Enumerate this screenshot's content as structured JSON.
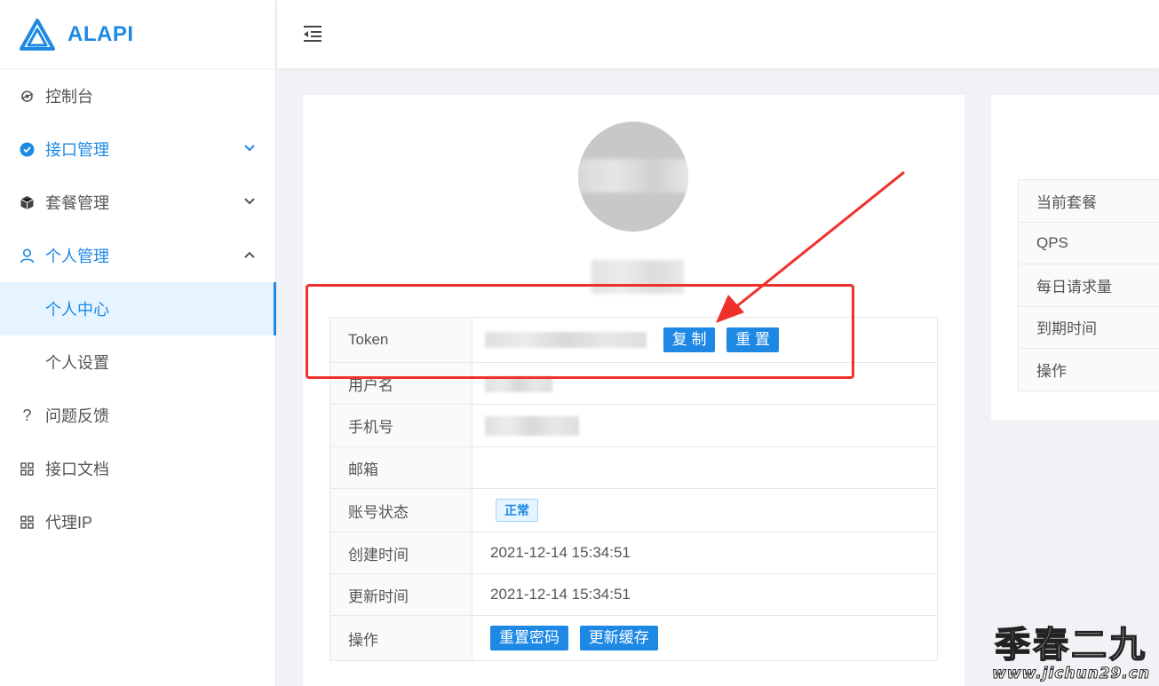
{
  "brand": {
    "name": "ALAPI"
  },
  "sidebar": {
    "items": [
      {
        "label": "控制台"
      },
      {
        "label": "接口管理"
      },
      {
        "label": "套餐管理"
      },
      {
        "label": "个人管理"
      },
      {
        "label": "个人中心"
      },
      {
        "label": "个人设置"
      },
      {
        "label": "问题反馈"
      },
      {
        "label": "接口文档"
      },
      {
        "label": "代理IP"
      }
    ]
  },
  "profile": {
    "rows": {
      "token": {
        "label": "Token",
        "copy_button": "复 制",
        "reset_button": "重 置"
      },
      "username": {
        "label": "用户名"
      },
      "phone": {
        "label": "手机号"
      },
      "email": {
        "label": "邮箱"
      },
      "status": {
        "label": "账号状态",
        "value": "正常"
      },
      "created": {
        "label": "创建时间",
        "value": "2021-12-14 15:34:51"
      },
      "updated": {
        "label": "更新时间",
        "value": "2021-12-14 15:34:51"
      },
      "actions": {
        "label": "操作",
        "reset_password_button": "重置密码",
        "refresh_cache_button": "更新缓存"
      }
    }
  },
  "plan": {
    "labels": [
      "当前套餐",
      "QPS",
      "每日请求量",
      "到期时间",
      "操作"
    ]
  },
  "watermark": {
    "title": "季春二九",
    "url": "www.jichun29.cn"
  },
  "colors": {
    "accent": "#1e88e5",
    "highlight": "#f0302a"
  }
}
